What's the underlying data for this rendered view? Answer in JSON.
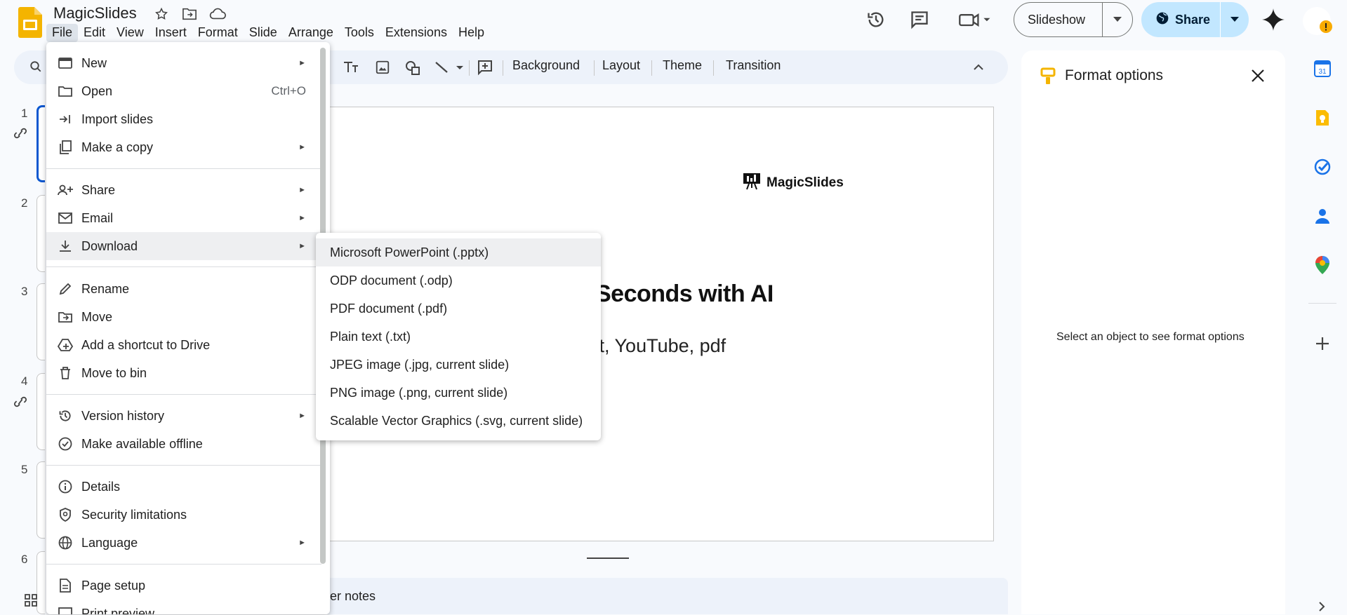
{
  "doc": {
    "title": "MagicSlides"
  },
  "menubar": [
    "File",
    "Edit",
    "View",
    "Insert",
    "Format",
    "Slide",
    "Arrange",
    "Tools",
    "Extensions",
    "Help"
  ],
  "header": {
    "slideshow_label": "Slideshow",
    "share_label": "Share"
  },
  "toolbar": {
    "background": "Background",
    "layout": "Layout",
    "theme": "Theme",
    "transition": "Transition"
  },
  "filmstrip": {
    "numbers": [
      "1",
      "2",
      "3",
      "4",
      "5",
      "6"
    ]
  },
  "slide": {
    "brand": "MagicSlides",
    "heading": "Seconds with AI",
    "subtitle": "xt, YouTube, pdf"
  },
  "notes": {
    "placeholder": "er notes"
  },
  "format_panel": {
    "title": "Format options",
    "empty_message": "Select an object to see format options"
  },
  "file_menu": {
    "new": "New",
    "open": "Open",
    "open_shortcut": "Ctrl+O",
    "import_slides": "Import slides",
    "make_copy": "Make a copy",
    "share": "Share",
    "email": "Email",
    "download": "Download",
    "rename": "Rename",
    "move": "Move",
    "add_shortcut": "Add a shortcut to Drive",
    "move_to_bin": "Move to bin",
    "version_history": "Version history",
    "make_offline": "Make available offline",
    "details": "Details",
    "security": "Security limitations",
    "language": "Language",
    "page_setup": "Page setup",
    "print_preview": "Print preview"
  },
  "download_menu": [
    "Microsoft PowerPoint (.pptx)",
    "ODP document (.odp)",
    "PDF document (.pdf)",
    "Plain text (.txt)",
    "JPEG image (.jpg, current slide)",
    "PNG image (.png, current slide)",
    "Scalable Vector Graphics (.svg, current slide)"
  ],
  "side_apps": {
    "calendar_day": "31"
  },
  "colors": {
    "slides_yellow": "#f4b400",
    "share_bg": "#c2e7ff",
    "menu_highlight": "#eeeff1"
  }
}
